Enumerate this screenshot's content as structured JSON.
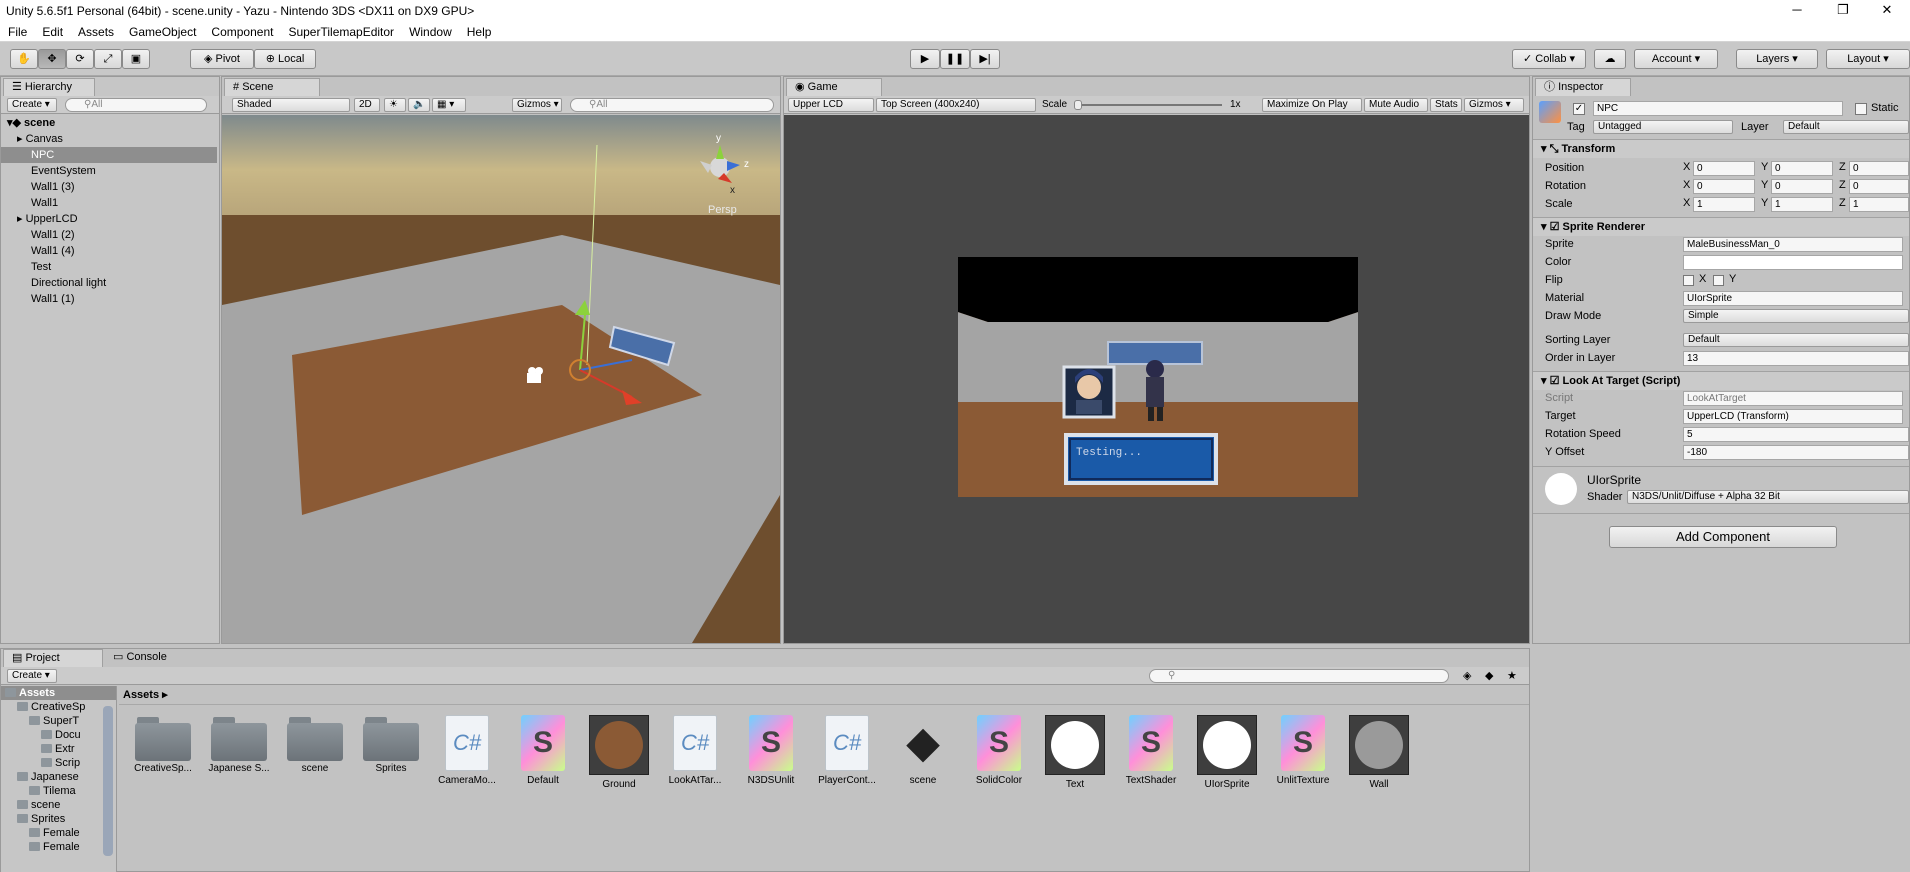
{
  "window": {
    "title": "Unity 5.6.5f1 Personal (64bit) - scene.unity - Yazu - Nintendo 3DS <DX11 on DX9 GPU>",
    "min": "─",
    "restore": "❐",
    "close": "✕"
  },
  "menu": [
    "File",
    "Edit",
    "Assets",
    "GameObject",
    "Component",
    "SuperTilemapEditor",
    "Window",
    "Help"
  ],
  "toolbar": {
    "pivot": "Pivot",
    "local": "Local",
    "collab": "Collab",
    "account": "Account",
    "layers": "Layers",
    "layout": "Layout"
  },
  "hierarchy": {
    "tab": "Hierarchy",
    "create": "Create",
    "search": "All",
    "scene": "scene",
    "items": [
      "Canvas",
      "NPC",
      "EventSystem",
      "Wall1 (3)",
      "Wall1",
      "UpperLCD",
      "Wall1 (2)",
      "Wall1 (4)",
      "Test",
      "Directional light",
      "Wall1 (1)"
    ]
  },
  "scene": {
    "tab": "Scene",
    "shading": "Shaded",
    "mode2d": "2D",
    "gizmos": "Gizmos",
    "search": "All",
    "persp": "Persp",
    "axis_y": "y",
    "axis_z": "z",
    "axis_x": "x"
  },
  "game": {
    "tab": "Game",
    "display": "Upper LCD",
    "resolution": "Top Screen (400x240)",
    "scale_label": "Scale",
    "scale_value": "1x",
    "maximize": "Maximize On Play",
    "mute": "Mute Audio",
    "stats": "Stats",
    "gizmos": "Gizmos",
    "dialog_text": "Testing..."
  },
  "inspector": {
    "tab": "Inspector",
    "name": "NPC",
    "static": "Static",
    "tag_label": "Tag",
    "tag": "Untagged",
    "layer_label": "Layer",
    "layer": "Default",
    "transform": {
      "title": "Transform",
      "rows": [
        {
          "label": "Position",
          "x": "0",
          "y": "0",
          "z": "0"
        },
        {
          "label": "Rotation",
          "x": "0",
          "y": "0",
          "z": "0"
        },
        {
          "label": "Scale",
          "x": "1",
          "y": "1",
          "z": "1"
        }
      ]
    },
    "sprite_renderer": {
      "title": "Sprite Renderer",
      "sprite_label": "Sprite",
      "sprite": "MaleBusinessMan_0",
      "color_label": "Color",
      "flip_label": "Flip",
      "flip_x": "X",
      "flip_y": "Y",
      "material_label": "Material",
      "material": "UIorSprite",
      "drawmode_label": "Draw Mode",
      "drawmode": "Simple",
      "sorting_label": "Sorting Layer",
      "sorting": "Default",
      "order_label": "Order in Layer",
      "order": "13"
    },
    "look_at": {
      "title": "Look At Target (Script)",
      "script_label": "Script",
      "script": "LookAtTarget",
      "target_label": "Target",
      "target": "UpperLCD (Transform)",
      "speed_label": "Rotation Speed",
      "speed": "5",
      "yoffset_label": "Y Offset",
      "yoffset": "-180"
    },
    "material": {
      "name": "UIorSprite",
      "shader_label": "Shader",
      "shader": "N3DS/Unlit/Diffuse + Alpha 32 Bit"
    },
    "add_component": "Add Component"
  },
  "project": {
    "tab": "Project",
    "console_tab": "Console",
    "create": "Create",
    "breadcrumb": "Assets",
    "tree": [
      {
        "label": "Assets",
        "indent": 0,
        "bold": true
      },
      {
        "label": "CreativeSp",
        "indent": 1
      },
      {
        "label": "SuperT",
        "indent": 2
      },
      {
        "label": "Docu",
        "indent": 3
      },
      {
        "label": "Extr",
        "indent": 3
      },
      {
        "label": "Scrip",
        "indent": 3
      },
      {
        "label": "Japanese",
        "indent": 1
      },
      {
        "label": "Tilema",
        "indent": 2
      },
      {
        "label": "scene",
        "indent": 1
      },
      {
        "label": "Sprites",
        "indent": 1
      },
      {
        "label": "Female",
        "indent": 2
      },
      {
        "label": "Female",
        "indent": 2
      }
    ],
    "assets": [
      {
        "label": "CreativeSp...",
        "kind": "folder"
      },
      {
        "label": "Japanese S...",
        "kind": "folder"
      },
      {
        "label": "scene",
        "kind": "folder"
      },
      {
        "label": "Sprites",
        "kind": "folder"
      },
      {
        "label": "CameraMo...",
        "kind": "cs"
      },
      {
        "label": "Default",
        "kind": "shader"
      },
      {
        "label": "Ground",
        "kind": "mat",
        "color": "#8b5a35"
      },
      {
        "label": "LookAtTar...",
        "kind": "cs"
      },
      {
        "label": "N3DSUnlit",
        "kind": "shader"
      },
      {
        "label": "PlayerCont...",
        "kind": "cs"
      },
      {
        "label": "scene",
        "kind": "unity"
      },
      {
        "label": "SolidColor",
        "kind": "shader"
      },
      {
        "label": "Text",
        "kind": "mat",
        "color": "#ffffff"
      },
      {
        "label": "TextShader",
        "kind": "shader"
      },
      {
        "label": "UIorSprite",
        "kind": "mat",
        "color": "#ffffff"
      },
      {
        "label": "UnlitTexture",
        "kind": "shader"
      },
      {
        "label": "Wall",
        "kind": "mat",
        "color": "#9a9a9a"
      }
    ]
  }
}
